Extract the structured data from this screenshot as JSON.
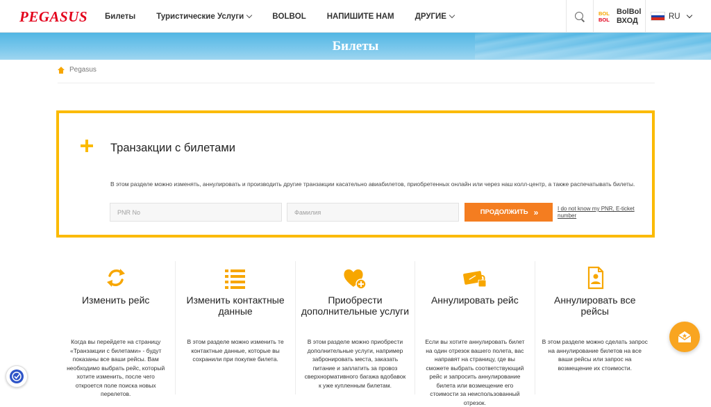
{
  "header": {
    "logo_text": "PEGASUS",
    "nav": [
      {
        "label": "Билеты",
        "has_dropdown": false
      },
      {
        "label": "Туристические Услуги",
        "has_dropdown": true
      },
      {
        "label": "BOLBOL",
        "has_dropdown": false
      },
      {
        "label": "НАПИШИТЕ НАМ",
        "has_dropdown": false
      },
      {
        "label": "ДРУГИЕ",
        "has_dropdown": true
      }
    ],
    "search_icon": "search-icon",
    "bolbol": {
      "logo_line1": "BOL",
      "logo_line2": "BOL",
      "line1": "BolBol",
      "line2": "ВХОД"
    },
    "language": {
      "label": "RU",
      "flag": "russia-flag-icon"
    }
  },
  "banner": {
    "title": "Билеты"
  },
  "breadcrumb": {
    "home_icon": "home-icon",
    "label": "Pegasus"
  },
  "transactions": {
    "title": "Транзакции с билетами",
    "description": "В этом разделе можно изменять, аннулировать и производить другие транзакции касательно авиабилетов, приобретенных онлайн или через наш колл-центр, а также распечатывать билеты.",
    "pnr_placeholder": "PNR No",
    "pnr_value": "",
    "surname_placeholder": "Фамилия",
    "surname_value": "",
    "continue_label": "ПРОДОЛЖИТЬ",
    "continue_icon": "»",
    "forgot_link": "I do not know my PNR, E-ticket number"
  },
  "features": [
    {
      "icon": "refresh-icon",
      "title": "Изменить рейс",
      "desc": "Когда вы перейдете на страницу «Транзакции с билетами» - будут показаны все ваши рейсы. Вам необходимо выбрать рейс, который хотите изменить, после чего откроется поле поиска новых перелетов."
    },
    {
      "icon": "list-icon",
      "title": "Изменить контактные данные",
      "desc": "В этом разделе можно изменить те контактные данные, которые вы сохранили при покупке билета."
    },
    {
      "icon": "heart-plus-icon",
      "title": "Приобрести дополнительные услуги",
      "desc": "В этом разделе можно приобрести дополнительные услуги, например забронировать места, заказать питание и заплатить за провоз сверхнормативного багажа вдобавок к уже купленным билетам."
    },
    {
      "icon": "ticket-lock-icon",
      "title": "Аннулировать рейс",
      "desc": "Если вы хотите аннулировать билет на один отрезок вашего полета, вас направят на страницу, где вы сможете выбрать соответствующий рейс и запросить аннулирование билета или возмещение его стоимости за неиспользованный отрезок."
    },
    {
      "icon": "document-person-icon",
      "title": "Аннулировать все рейсы",
      "desc": "В этом разделе можно сделать запрос на аннулирование билетов на все ваши рейсы или запрос на возмещение их стоимости."
    }
  ],
  "widgets": {
    "chat_icon": "chat-envelope-icon",
    "accessibility_icon": "accessibility-icon"
  },
  "colors": {
    "brand_red": "#e3001b",
    "accent_yellow": "#fbba00",
    "button_orange": "#f47d20",
    "banner_blue": "#52b6e3"
  }
}
